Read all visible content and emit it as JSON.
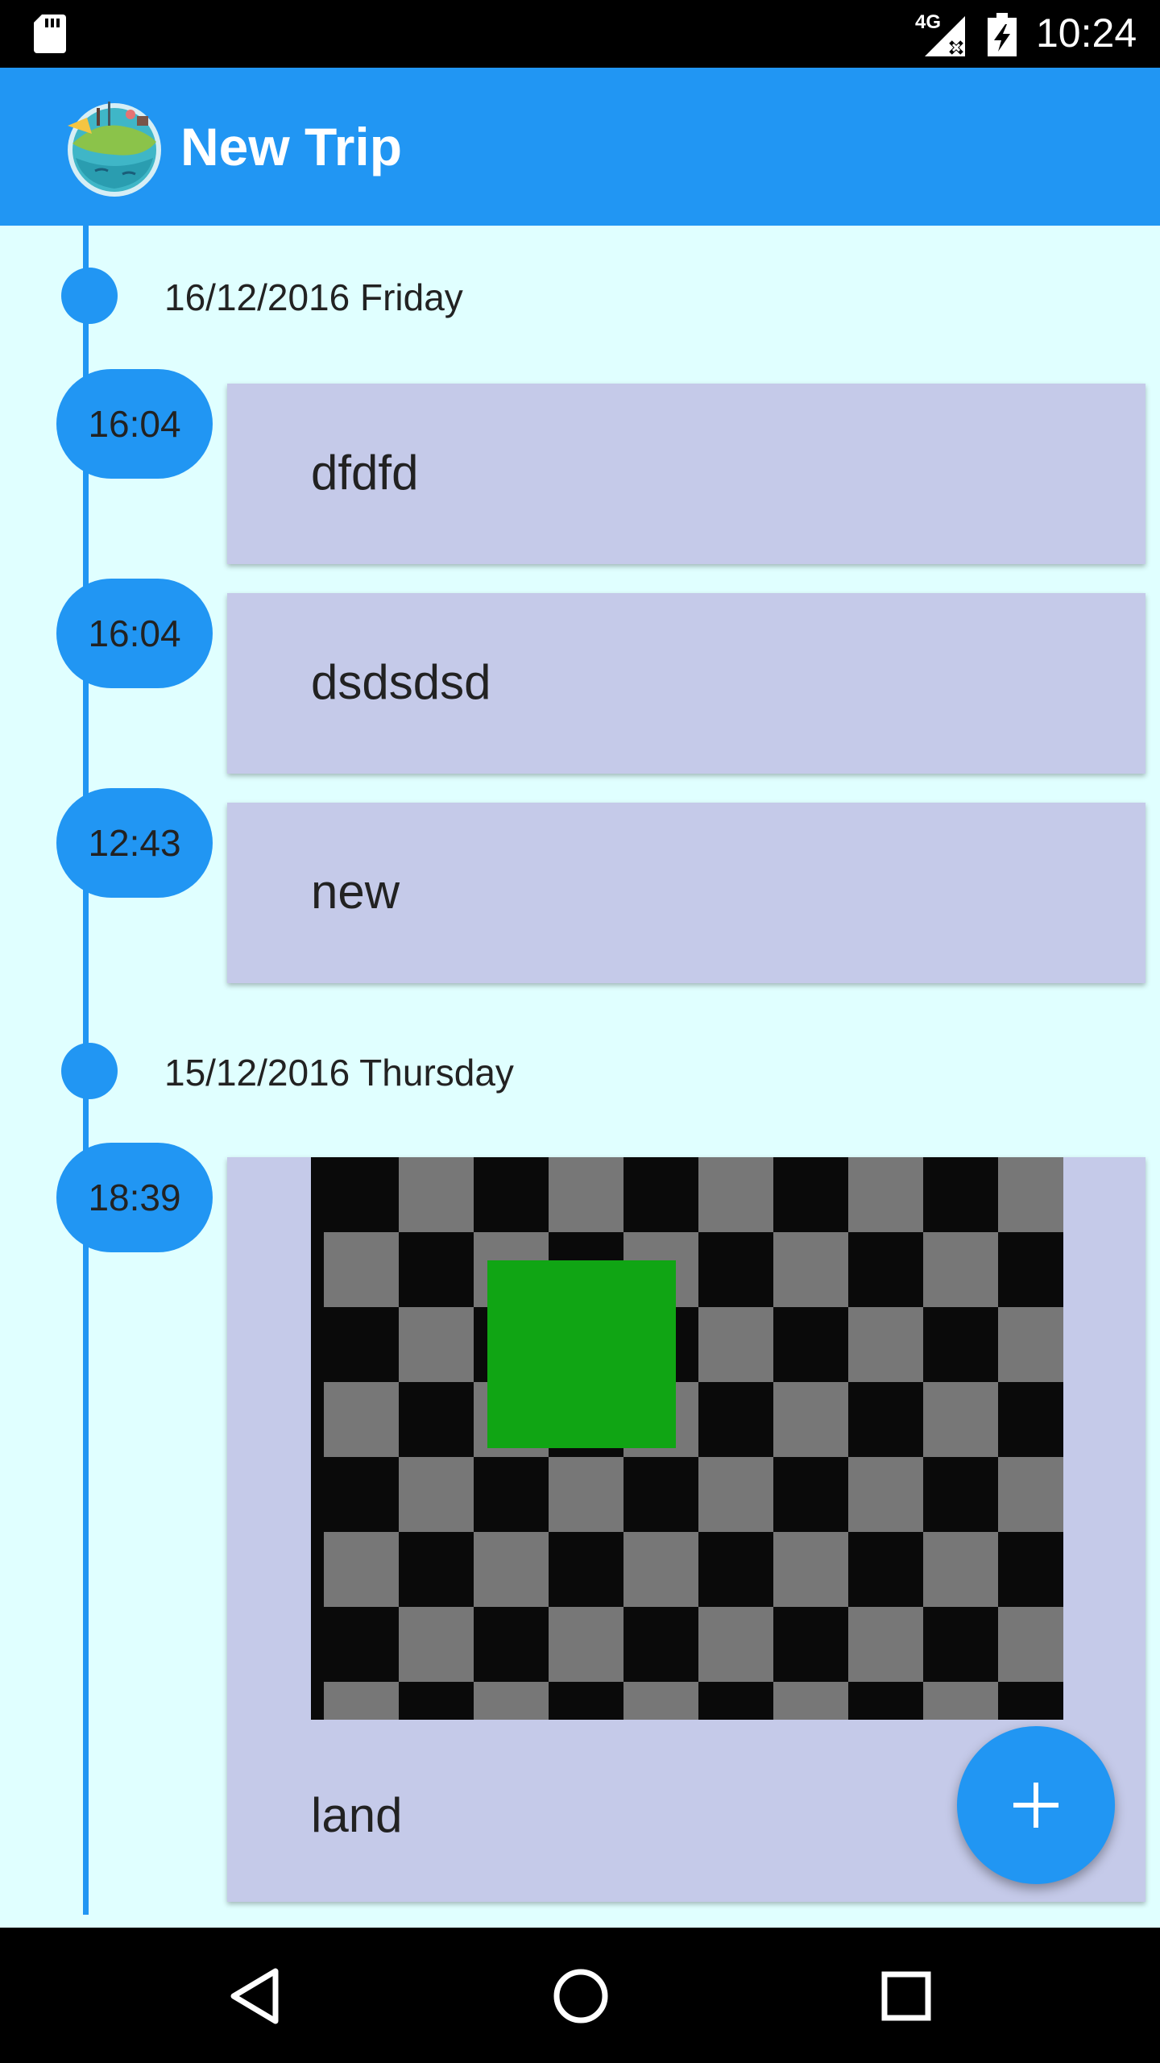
{
  "status_bar": {
    "network": "4G",
    "time": "10:24"
  },
  "app_bar": {
    "title": "New Trip"
  },
  "timeline": {
    "groups": [
      {
        "date": "16/12/2016 Friday",
        "entries": [
          {
            "time": "16:04",
            "text": "dfdfd"
          },
          {
            "time": "16:04",
            "text": "dsdsdsd"
          },
          {
            "time": "12:43",
            "text": "new"
          }
        ]
      },
      {
        "date": "15/12/2016 Thursday",
        "entries": [
          {
            "time": "18:39",
            "text": "land",
            "has_image": true
          }
        ]
      }
    ]
  },
  "fab": {
    "icon": "plus-icon"
  },
  "navigation": {
    "back": "back-icon",
    "home": "home-icon",
    "recents": "recents-icon"
  },
  "colors": {
    "primary": "#2196F3",
    "background": "#E0FFFF",
    "card": "#C5CAE9",
    "image_green": "#10A514"
  }
}
